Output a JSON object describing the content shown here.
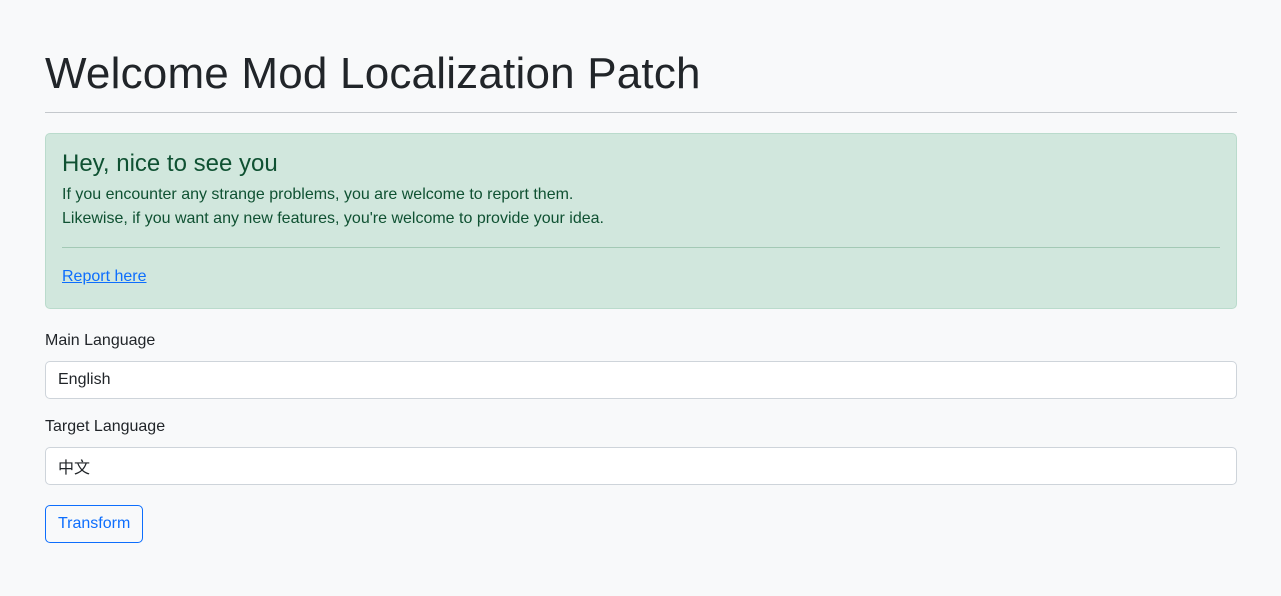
{
  "page": {
    "title": "Welcome Mod Localization Patch"
  },
  "alert": {
    "heading": "Hey, nice to see you",
    "line1": "If you encounter any strange problems, you are welcome to report them.",
    "line2": "Likewise, if you want any new features, you're welcome to provide your idea.",
    "link_label": "Report here"
  },
  "form": {
    "main_language": {
      "label": "Main Language",
      "value": "English"
    },
    "target_language": {
      "label": "Target Language",
      "value": "中文"
    },
    "submit_label": "Transform"
  },
  "colors": {
    "background": "#f8f9fa",
    "alert_background": "#d1e7dd",
    "alert_text": "#0f5132",
    "primary": "#0d6efd"
  }
}
